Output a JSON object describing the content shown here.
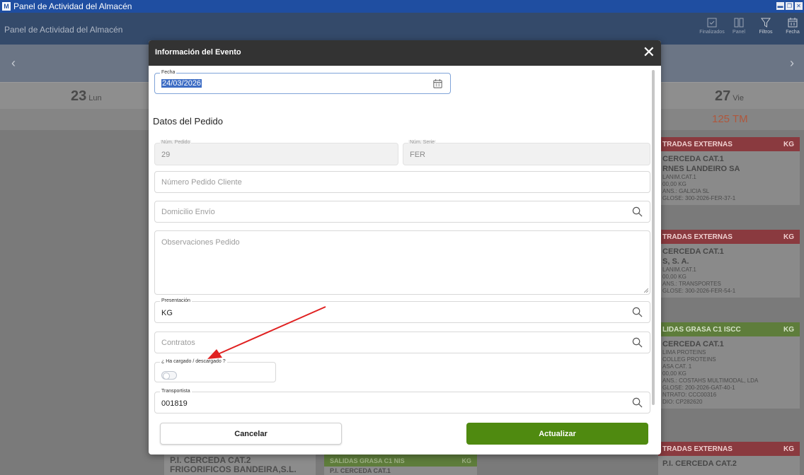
{
  "window": {
    "title": "Panel de Actividad del Almacén",
    "controls": [
      "▬",
      "❐",
      "✕"
    ]
  },
  "app": {
    "title": "Panel de Actividad del Almacén",
    "tools": [
      {
        "label": "Finalizados",
        "icon": "check-square-icon"
      },
      {
        "label": "Panel",
        "icon": "panel-icon"
      },
      {
        "label": "Filtros",
        "icon": "filter-icon"
      },
      {
        "label": "Fecha",
        "icon": "calendar-icon"
      }
    ]
  },
  "calendar": {
    "prev": "‹",
    "next": "›",
    "days": [
      {
        "num": "23",
        "name": "Lun"
      },
      {
        "num": "27",
        "name": "Vie"
      }
    ],
    "total": "125 TM",
    "cards": [
      {
        "header": "TRADAS EXTERNAS",
        "unit": "KG",
        "lines": [
          "CERCEDA CAT.1",
          "RNES LANDEIRO SA",
          "LANIM.CAT.1",
          "00,00 KG",
          "ANS.: GALICIA SL",
          "GLOSE: 300-2026-FER-37-1"
        ]
      },
      {
        "header": "TRADAS EXTERNAS",
        "unit": "KG",
        "lines": [
          "CERCEDA CAT.1",
          "S, S. A.",
          "LANIM.CAT.1",
          "00,00 KG",
          "ANS.: TRANSPORTES",
          "GLOSE: 300-2026-FER-54-1"
        ]
      },
      {
        "header": "LIDAS GRASA C1 ISCC",
        "unit": "KG",
        "lines": [
          "CERCEDA CAT.1",
          "LIMA PROTEINS",
          "COLLEG PROTEINS",
          "ASA CAT. 1",
          "00,00 KG",
          "ANS.: COSTAHS MULTIMODAL, LDA",
          "GLOSE: 200-2026-GAT-40-1",
          "NTRATO: CCC00316",
          "DIO: CP282620"
        ]
      },
      {
        "header": "TRADAS EXTERNAS",
        "unit": "KG",
        "lines": [
          "P.I. CERCEDA CAT.2"
        ]
      }
    ],
    "bottom": {
      "left_line1": "P.I. CERCEDA CAT.2",
      "left_line2": "FRIGORIFICOS BANDEIRA,S.L.",
      "mid_header": "SALIDAS GRASA C1 NIS",
      "mid_unit": "KG",
      "mid_line": "P.I. CERCEDA CAT.1"
    }
  },
  "modal": {
    "title": "Información del Evento",
    "close": "✕",
    "fecha": {
      "label": "Fecha",
      "value": "24/03/2026"
    },
    "section": "Datos del Pedido",
    "num_pedido": {
      "label": "Núm. Pedido",
      "value": "29"
    },
    "num_serie": {
      "label": "Núm. Serie",
      "value": "FER"
    },
    "numero_cliente": {
      "placeholder": "Número Pedido Cliente"
    },
    "domicilio": {
      "placeholder": "Domicilio Envío"
    },
    "observaciones": {
      "placeholder": "Observaciones Pedido"
    },
    "presentacion": {
      "label": "Presentación",
      "value": "KG"
    },
    "contratos": {
      "placeholder": "Contratos"
    },
    "cargado": {
      "label": "¿ Ha cargado / descargado ?",
      "checked": false
    },
    "transportista": {
      "label": "Transportista",
      "value": "001819"
    },
    "cancel": "Cancelar",
    "update": "Actualizar"
  },
  "colors": {
    "primary_green": "#4f8a10",
    "header_dark": "#333333",
    "annotation_arrow": "#e02020"
  }
}
